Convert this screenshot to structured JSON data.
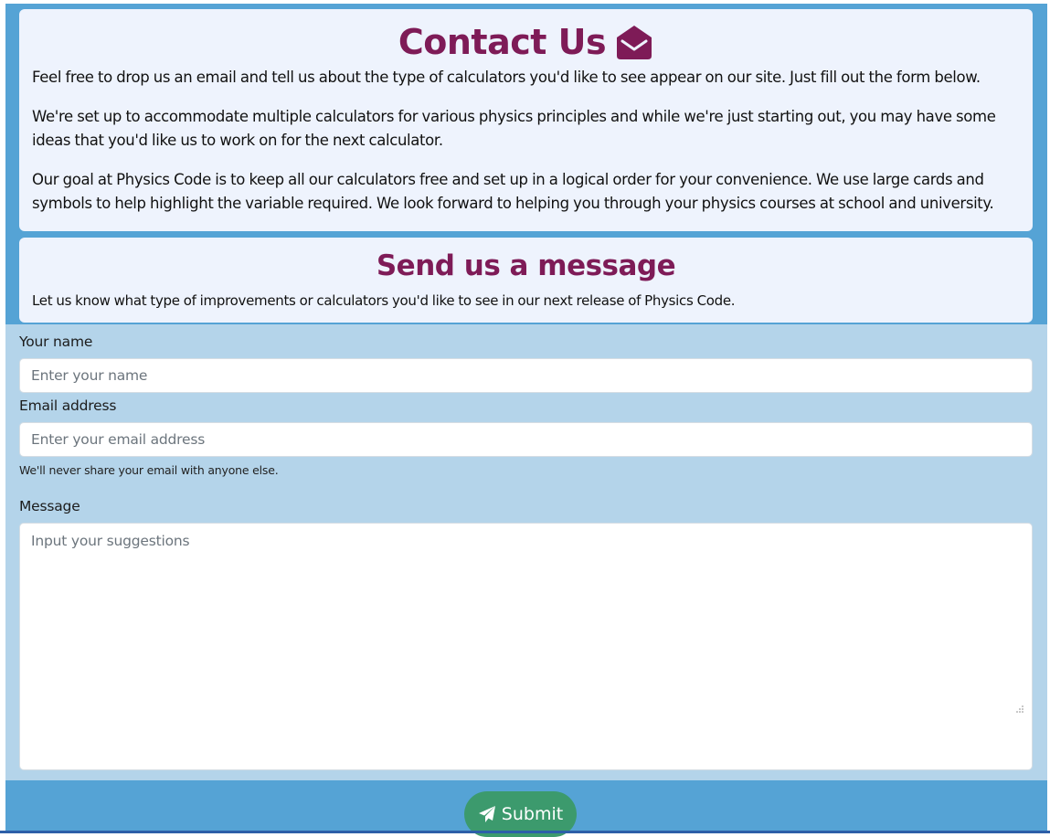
{
  "contact": {
    "title": "Contact Us",
    "icon": "envelope-open-icon",
    "paragraphs": [
      "Feel free to drop us an email and tell us about the type of calculators you'd like to see appear on our site. Just fill out the form below.",
      "We're set up to accommodate multiple calculators for various physics principles and while we're just starting out, you may have some ideas that you'd like us to work on for the next calculator.",
      "Our goal at Physics Code is to keep all our calculators free and set up in a logical order for your convenience. We use large cards and symbols to help highlight the variable required. We look forward to helping you through your physics courses at school and university."
    ]
  },
  "send": {
    "title": "Send us a message",
    "intro": "Let us know what type of improvements or calculators you'd like to see in our next release of Physics Code."
  },
  "form": {
    "name_label": "Your name",
    "name_placeholder": "Enter your name",
    "name_value": "",
    "email_label": "Email address",
    "email_placeholder": "Enter your email address",
    "email_value": "",
    "email_help": "We'll never share your email with anyone else.",
    "message_label": "Message",
    "message_placeholder": "Input your suggestions",
    "message_value": "",
    "submit_label": "Submit",
    "submit_icon": "paper-plane-icon"
  },
  "colors": {
    "frame": "#55a3d5",
    "card": "#eef3fd",
    "heading": "#7e1b57",
    "form_background": "#b4d4ea",
    "submit": "#3c9a6d"
  }
}
